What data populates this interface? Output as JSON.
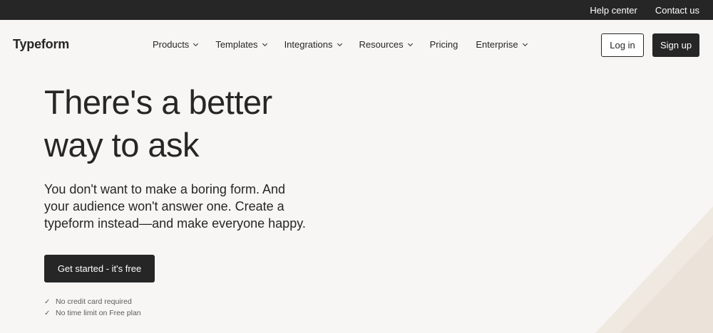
{
  "topbar": {
    "help_center": "Help center",
    "contact_us": "Contact us"
  },
  "nav": {
    "logo": "Typeform",
    "items": [
      {
        "label": "Products",
        "has_dropdown": true
      },
      {
        "label": "Templates",
        "has_dropdown": true
      },
      {
        "label": "Integrations",
        "has_dropdown": true
      },
      {
        "label": "Resources",
        "has_dropdown": true
      },
      {
        "label": "Pricing",
        "has_dropdown": false
      },
      {
        "label": "Enterprise",
        "has_dropdown": true
      }
    ],
    "login_label": "Log in",
    "signup_label": "Sign up"
  },
  "hero": {
    "title_line1": "There's a better",
    "title_line2": "way to ask",
    "subtitle_line1": "You don't want to make a boring form. And",
    "subtitle_line2": "your audience won't answer one. Create a",
    "subtitle_line3": "typeform instead—and make everyone happy.",
    "cta_label": "Get started - it's free",
    "checks": [
      "No credit card required",
      "No time limit on Free plan"
    ]
  },
  "colors": {
    "background": "#f7f6f4",
    "dark": "#262627",
    "decor": "#ece5dc"
  }
}
